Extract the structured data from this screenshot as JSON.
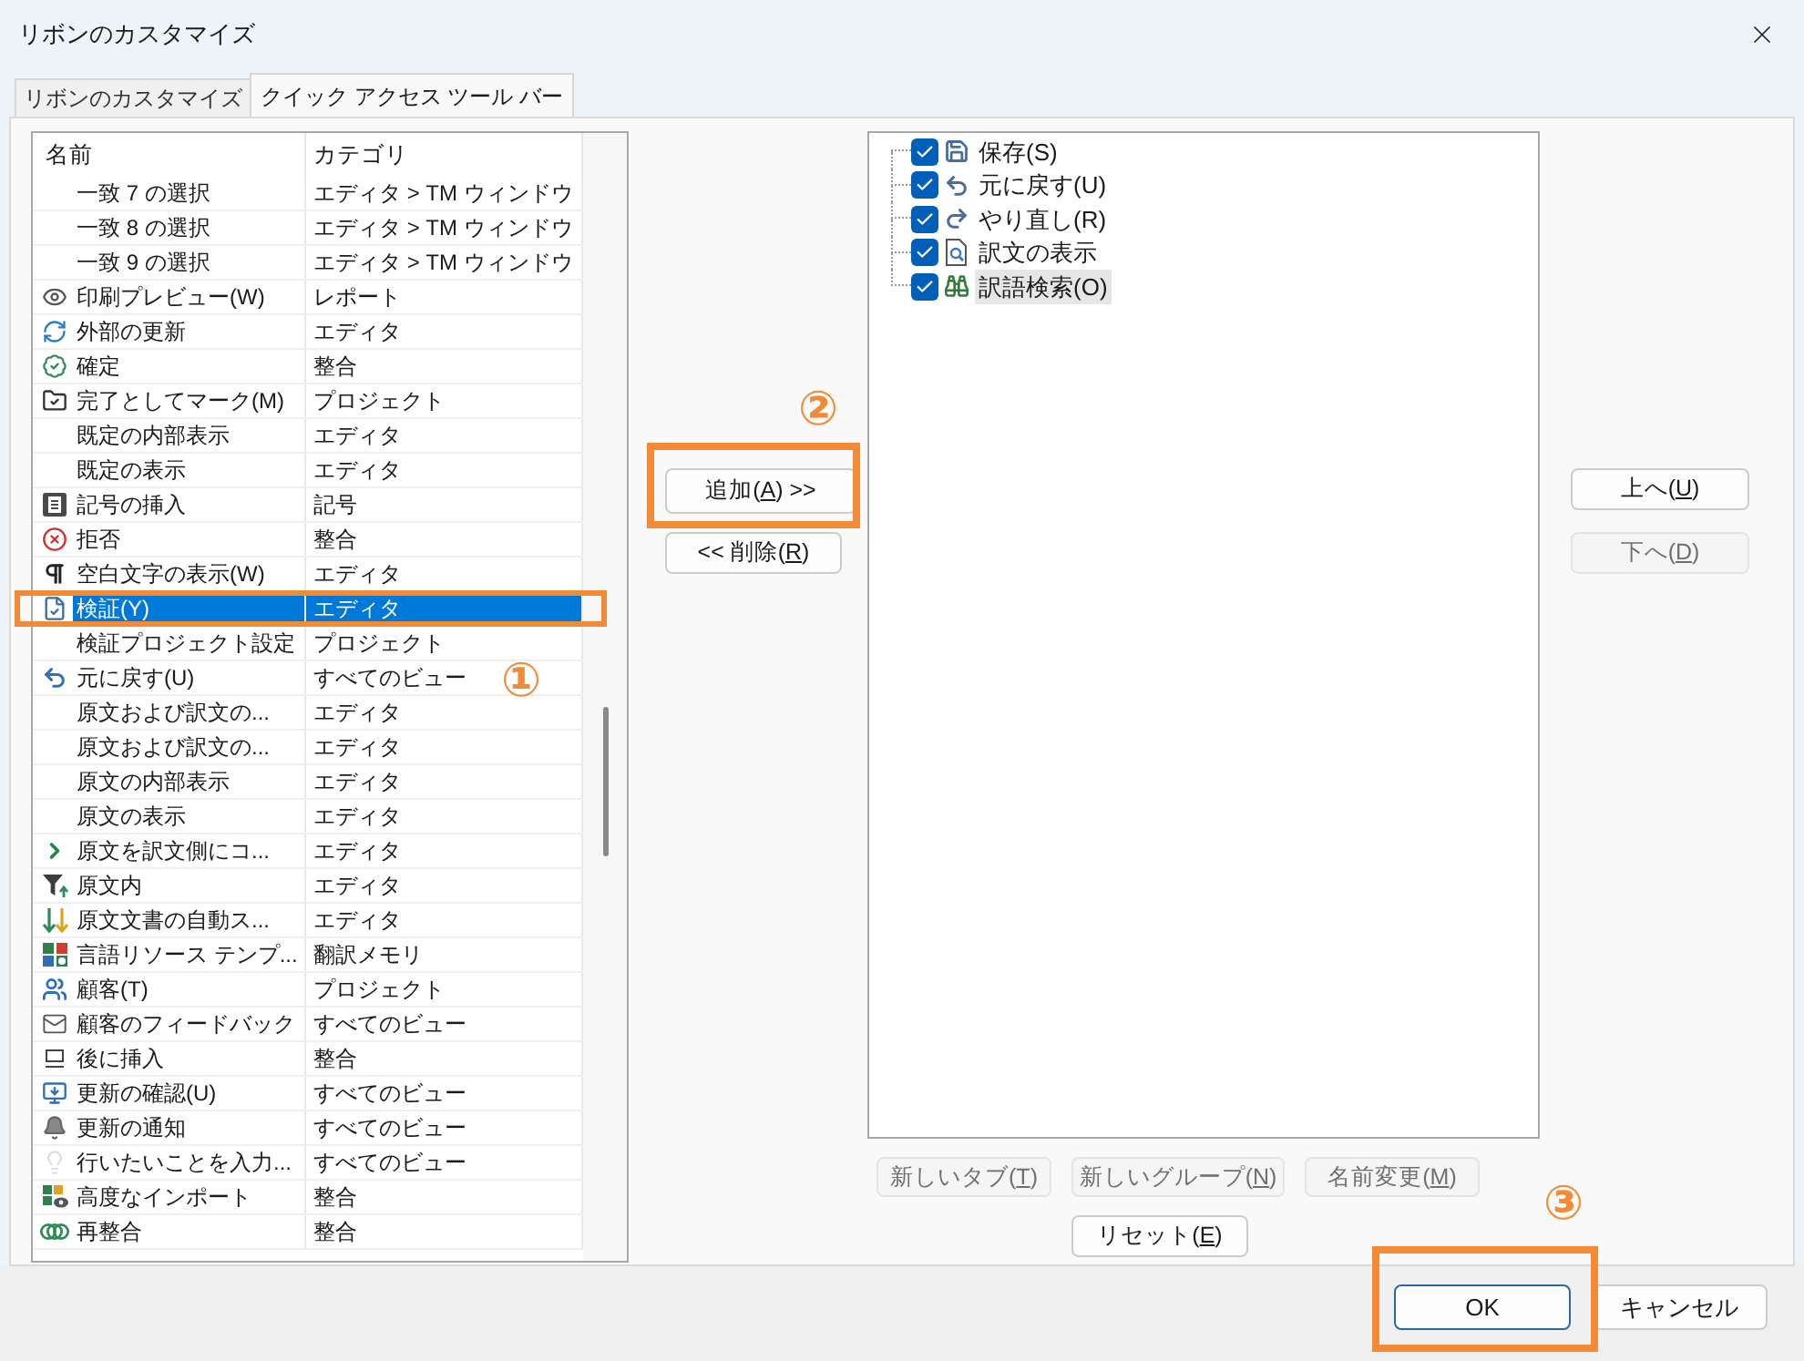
{
  "window": {
    "title": "リボンのカスタマイズ"
  },
  "tabs": [
    {
      "label": "リボンのカスタマイズ",
      "selected": false
    },
    {
      "label": "クイック アクセス ツール バー",
      "selected": true
    }
  ],
  "command_list": {
    "columns": [
      "名前",
      "カテゴリ"
    ],
    "rows": [
      {
        "name": "一致 7 の選択",
        "category": "エディタ > TM ウィンドウ",
        "selected": false
      },
      {
        "name": "一致 8 の選択",
        "category": "エディタ > TM ウィンドウ",
        "selected": false
      },
      {
        "name": "一致 9 の選択",
        "category": "エディタ > TM ウィンドウ",
        "selected": false
      },
      {
        "name": "印刷プレビュー(W)",
        "category": "レポート",
        "selected": false
      },
      {
        "name": "外部の更新",
        "category": "エディタ",
        "selected": false
      },
      {
        "name": "確定",
        "category": "整合",
        "selected": false
      },
      {
        "name": "完了としてマーク(M)",
        "category": "プロジェクト",
        "selected": false
      },
      {
        "name": "既定の内部表示",
        "category": "エディタ",
        "selected": false
      },
      {
        "name": "既定の表示",
        "category": "エディタ",
        "selected": false
      },
      {
        "name": "記号の挿入",
        "category": "記号",
        "selected": false
      },
      {
        "name": "拒否",
        "category": "整合",
        "selected": false
      },
      {
        "name": "空白文字の表示(W)",
        "category": "エディタ",
        "selected": false
      },
      {
        "name": "検証(Y)",
        "category": "エディタ",
        "selected": true
      },
      {
        "name": "検証プロジェクト設定",
        "category": "プロジェクト",
        "selected": false
      },
      {
        "name": "元に戻す(U)",
        "category": "すべてのビュー",
        "selected": false
      },
      {
        "name": "原文および訳文の...",
        "category": "エディタ",
        "selected": false
      },
      {
        "name": "原文および訳文の...",
        "category": "エディタ",
        "selected": false
      },
      {
        "name": "原文の内部表示",
        "category": "エディタ",
        "selected": false
      },
      {
        "name": "原文の表示",
        "category": "エディタ",
        "selected": false
      },
      {
        "name": "原文を訳文側にコ...",
        "category": "エディタ",
        "selected": false
      },
      {
        "name": "原文内",
        "category": "エディタ",
        "selected": false
      },
      {
        "name": "原文文書の自動ス...",
        "category": "エディタ",
        "selected": false
      },
      {
        "name": "言語リソース テンプ...",
        "category": "翻訳メモリ",
        "selected": false
      },
      {
        "name": "顧客(T)",
        "category": "プロジェクト",
        "selected": false
      },
      {
        "name": "顧客のフィードバック",
        "category": "すべてのビュー",
        "selected": false
      },
      {
        "name": "後に挿入",
        "category": "整合",
        "selected": false
      },
      {
        "name": "更新の確認(U)",
        "category": "すべてのビュー",
        "selected": false
      },
      {
        "name": "更新の通知",
        "category": "すべてのビュー",
        "selected": false
      },
      {
        "name": "行いたいことを入力...",
        "category": "すべてのビュー",
        "selected": false
      },
      {
        "name": "高度なインポート",
        "category": "整合",
        "selected": false
      },
      {
        "name": "再整合",
        "category": "整合",
        "selected": false
      }
    ]
  },
  "transfer_buttons": [
    {
      "label": "追加(A) >>",
      "key_underlined": true,
      "disabled": false
    },
    {
      "label": "<< 削除(R)",
      "key_underlined": true,
      "disabled": false
    }
  ],
  "toolbar_items": [
    {
      "label": "保存(S)",
      "checked": true,
      "selected": false
    },
    {
      "label": "元に戻す(U)",
      "checked": true,
      "selected": false
    },
    {
      "label": "やり直し(R)",
      "checked": true,
      "selected": false
    },
    {
      "label": "訳文の表示",
      "checked": true,
      "selected": false
    },
    {
      "label": "訳語検索(O)",
      "checked": true,
      "selected": true
    }
  ],
  "order_buttons": [
    {
      "label": "上へ(U)",
      "key_underlined": true,
      "disabled": false
    },
    {
      "label": "下へ(D)",
      "key_underlined": true,
      "disabled": true
    }
  ],
  "tab_buttons": [
    {
      "label": "新しいタブ(T)",
      "key_underlined": true,
      "disabled": true
    },
    {
      "label": "新しいグループ(N)",
      "key_underlined": true,
      "disabled": true
    },
    {
      "label": "名前変更(M)",
      "key_underlined": true,
      "disabled": true
    }
  ],
  "reset_button": {
    "label": "リセット(E)",
    "key_underlined": true,
    "disabled": false
  },
  "footer_buttons": [
    {
      "label": "OK",
      "default": true
    },
    {
      "label": "キャンセル",
      "default": false
    }
  ],
  "annotations": [
    {
      "number": "①"
    },
    {
      "number": "②"
    },
    {
      "number": "③"
    }
  ]
}
